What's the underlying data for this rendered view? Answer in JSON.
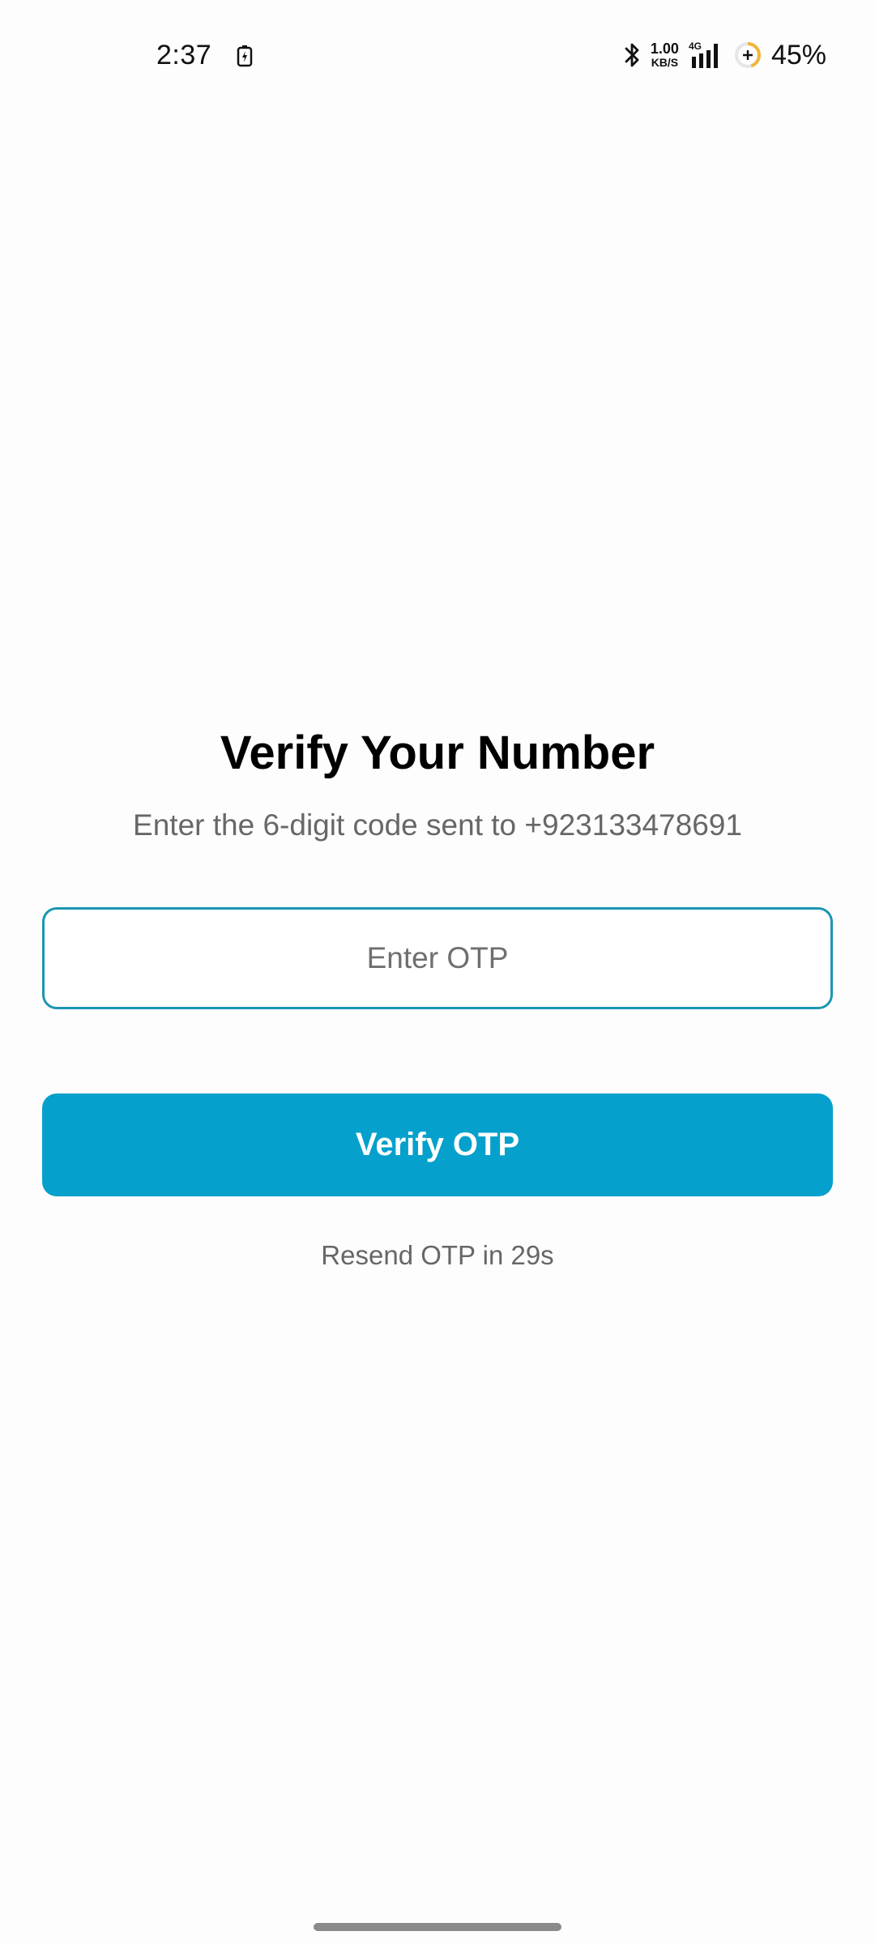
{
  "status_bar": {
    "time": "2:37",
    "net_speed_value": "1.00",
    "net_speed_unit": "KB/S",
    "network_type": "4G",
    "battery_percent": "45%",
    "icons": [
      "battery-saver-icon",
      "bluetooth-icon",
      "signal-icon",
      "battery-ring-icon"
    ]
  },
  "main": {
    "title": "Verify Your Number",
    "subtitle": "Enter the 6-digit code sent to +923133478691",
    "otp_input": {
      "value": "",
      "placeholder": "Enter OTP"
    },
    "verify_button_label": "Verify OTP",
    "resend_text": "Resend OTP in 29s"
  },
  "colors": {
    "accent": "#05a0cc",
    "input_border": "#1a96b3",
    "muted_text": "#676767",
    "battery_ring": "#f2b53a"
  }
}
